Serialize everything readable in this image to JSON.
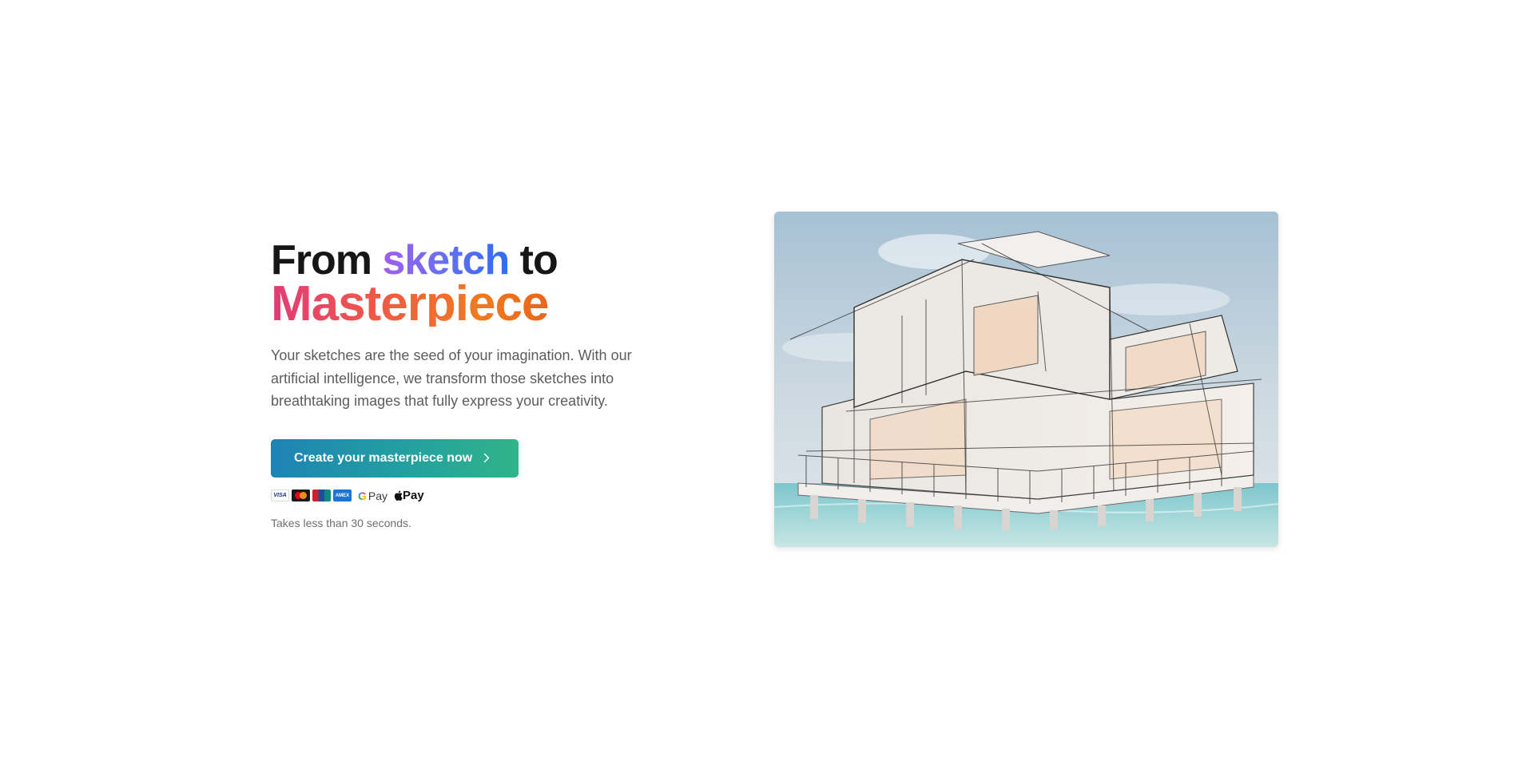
{
  "hero": {
    "headline": {
      "from": "From",
      "sketch": "sketch",
      "to": "to",
      "masterpiece": "Masterpiece"
    },
    "description": "Your sketches are the seed of your imagination. With our artificial intelligence, we transform those sketches into breathtaking images that fully express your creativity.",
    "cta_label": "Create your masterpiece now",
    "cta_icon": "chevron-right-icon",
    "payment_methods": [
      {
        "name": "visa-icon",
        "label": "VISA"
      },
      {
        "name": "mastercard-icon"
      },
      {
        "name": "unionpay-icon"
      },
      {
        "name": "amex-icon",
        "label": "AMEX"
      },
      {
        "name": "google-pay-icon",
        "g": "G",
        "label": "Pay"
      },
      {
        "name": "apple-pay-icon",
        "label": "Pay"
      }
    ],
    "note": "Takes less than 30 seconds.",
    "image": {
      "description_icon": "sketched-house-over-water-image"
    }
  },
  "colors": {
    "sketch_gradient": [
      "#a35cf0",
      "#2e6ef0"
    ],
    "masterpiece_gradient": [
      "#e23a78",
      "#f07a20"
    ],
    "cta_gradient": [
      "#1e83b4",
      "#30b489"
    ]
  }
}
